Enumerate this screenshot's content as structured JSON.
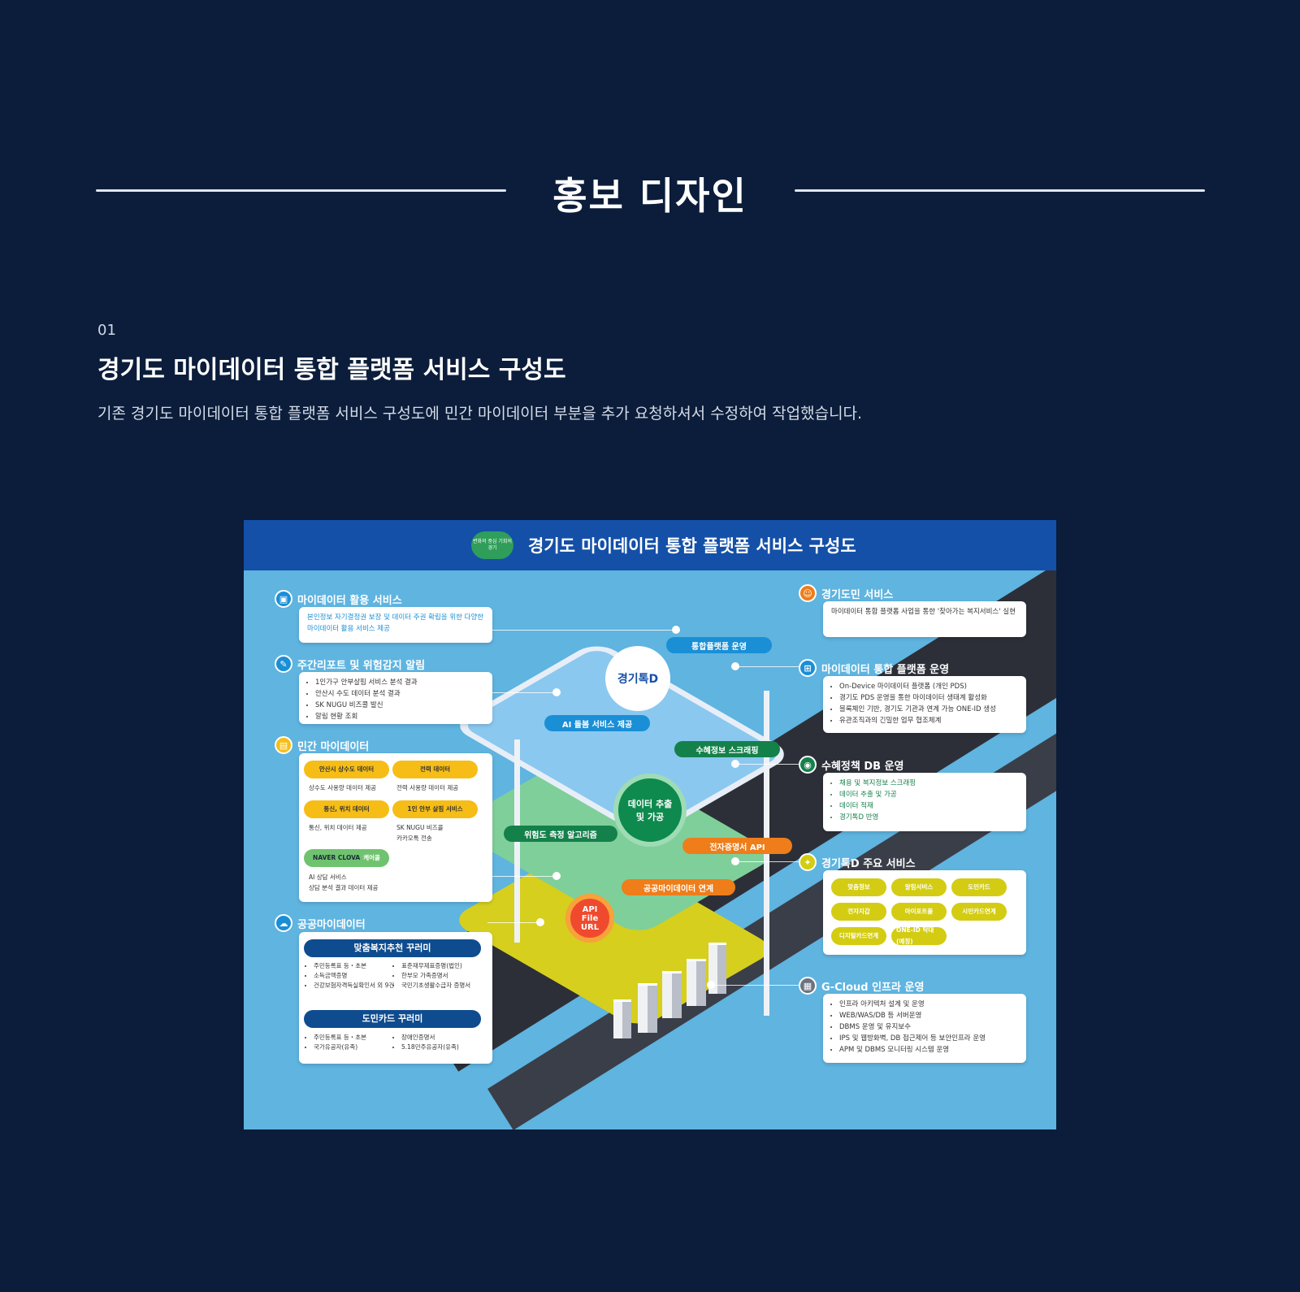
{
  "header": {
    "title": "홍보 디자인"
  },
  "section": {
    "number": "01",
    "title": "경기도 마이데이터 통합 플랫폼 서비스 구성도",
    "description": "기존 경기도 마이데이터 통합 플랫폼 서비스 구성도에 민간 마이데이터 부분을 추가 요청하셔서 수정하여 작업했습니다."
  },
  "poster": {
    "title": "경기도 마이데이터 통합 플랫폼 서비스 구성도",
    "logo_text": "변화의 중심 기회의 경기",
    "left": {
      "mydata_service": {
        "label": "마이데이터 활용 서비스",
        "text": "본인정보 자기결정권 보장 및 데이터 주권 확립을 위한 다양한 마이데이터 활용 서비스 제공"
      },
      "weekly_report": {
        "label": "주간리포트 및 위험감지 알림",
        "items": [
          "1인가구 안부살핌 서비스 분석 결과",
          "안산시 수도 데이터 분석 결과",
          "SK NUGU 비즈콜 발신",
          "알림 현황 조회"
        ]
      },
      "private_mydata": {
        "label": "민간 마이데이터",
        "chips": [
          "안산시 상수도 데이터",
          "전력 데이터",
          "통신, 위치 데이터",
          "1인 안부 살핌 서비스"
        ],
        "chip_items": [
          "상수도 사용량 데이터 제공",
          "전력 사용량 데이터 제공",
          "통신, 위치 데이터 제공",
          "SK NUGU 비즈콜",
          "카카오톡 전송"
        ],
        "clova_brand": "NAVER CLOVA",
        "clova_label": "케어콜",
        "clova_items": [
          "AI 상담 서비스",
          "상담 분석 결과 데이터 제공"
        ]
      },
      "public_mydata": {
        "label": "공공마이데이터",
        "package1": "맞춤복지추천 꾸러미",
        "package1_items_a": [
          "주민등록표 등・초본",
          "소득금액증명",
          "건강보험자격득실확인서 외 9건"
        ],
        "package1_items_b": [
          "표준재무제표증명(법인)",
          "한부모 가족증명서",
          "국민기초생활수급자 증명서"
        ],
        "package2": "도민카드 꾸러미",
        "package2_items_a": [
          "주민등록표 등・초본",
          "국가유공자(유족)"
        ],
        "package2_items_b": [
          "장애인증명서",
          "5.18민주유공자(유족)"
        ]
      }
    },
    "right": {
      "citizen_service": {
        "label": "경기도민 서비스",
        "text": "마이데이터 통합 플랫폼 사업을 통한 '찾아가는 복지서비스' 실현"
      },
      "platform_ops": {
        "label": "마이데이터 통합 플랫폼 운영",
        "items": [
          "On-Device 마이데이터 플랫폼 (개인 PDS)",
          "경기도 PDS 운영을 통한 마이데이터 생태계 활성화",
          "블록체인 기반, 경기도 기관과 연계 가능 ONE-ID 생성",
          "유관조직과의 긴밀한 업무 협조체계"
        ]
      },
      "welfare_db": {
        "label": "수혜정책 DB 운영",
        "items": [
          "채용 및 복지정보 스크래핑",
          "데이터 추출 및 가공",
          "데이터 적재",
          "경기톡D 반영"
        ]
      },
      "talk_d": {
        "label": "경기톡D 주요 서비스",
        "chips": [
          "맞춤정보",
          "알림서비스",
          "도민카드",
          "전자지갑",
          "마이포트폴",
          "시민카드연계",
          "디지털카드연계",
          "ONE-ID 탁대(예정)"
        ]
      },
      "gcloud": {
        "label": "G-Cloud 인프라 운영",
        "items": [
          "인프라 아키텍처 설계 및 운영",
          "WEB/WAS/DB 등 서버운영",
          "DBMS 운영 및 유지보수",
          "IPS 및 웹방화벽, DB 접근제어 등 보안인프라 운영",
          "APM 및 DBMS 모니터링 시스템 운영"
        ]
      }
    },
    "center": {
      "brand": "경기톡D",
      "platform_pill": "통합플랫폼 운영",
      "ai_pill": "AI 돌봄 서비스 제공",
      "scrape_pill": "수혜정보 스크래핑",
      "extract": "데이터 추출 및 가공",
      "risk_pill": "위험도 측정 알고리즘",
      "cert_pill": "전자증명서 API",
      "public_link_pill": "공공마이데이터 연계",
      "api_circle": "API File URL"
    },
    "colors": {
      "bg": "#0b1d3a",
      "poster_bg": "#5fb4e0",
      "poster_head": "#1450a8",
      "accent_yellow": "#f6bd16",
      "accent_lime": "#d3cc12",
      "accent_green": "#2f9e5a",
      "accent_orange": "#ee7d1a",
      "accent_blue": "#1a8fd6"
    }
  }
}
